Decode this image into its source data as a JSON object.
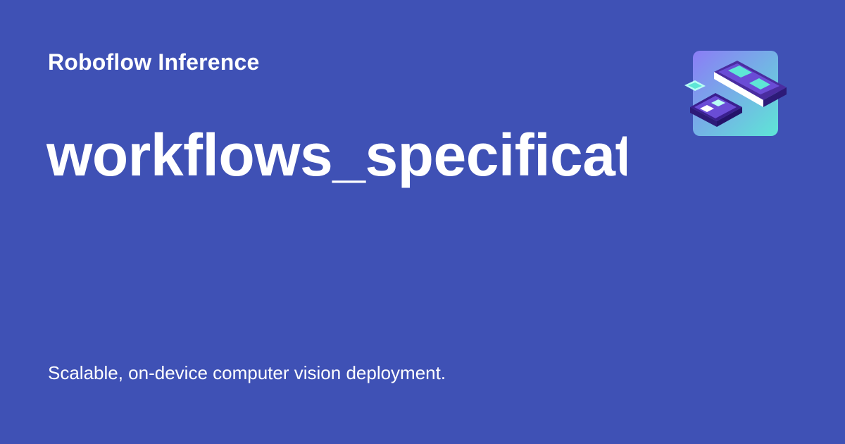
{
  "header": {
    "site_name": "Roboflow Inference"
  },
  "main": {
    "title": "workflows_specification"
  },
  "footer": {
    "description": "Scalable, on-device computer vision deployment."
  },
  "logo": {
    "icon": "hardware-chip-logo-icon"
  },
  "colors": {
    "background": "#3f51b5",
    "text": "#ffffff",
    "logo_gradient_start": "#8b7cf6",
    "logo_gradient_end": "#5ee6d6"
  }
}
